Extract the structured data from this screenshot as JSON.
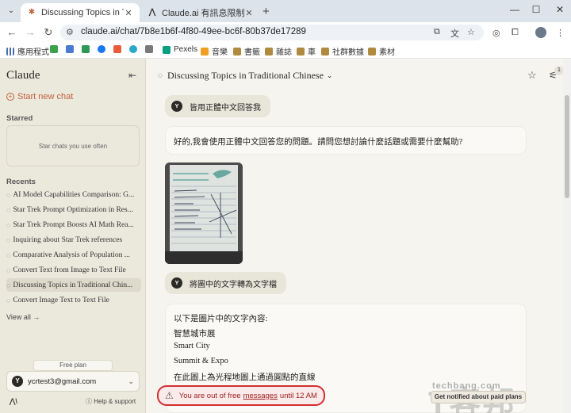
{
  "browser": {
    "tabs": [
      {
        "title": "Discussing Topics in Traditional",
        "active": true
      },
      {
        "title": "Claude.ai 有訊息限制嗎？| 人為",
        "active": false
      }
    ],
    "url": "claude.ai/chat/7b8e1b6f-4f80-49ee-bc6f-80b37de17289",
    "bookmarks": [
      "應用程式",
      "Pexels",
      "音樂",
      "書籤",
      "雜誌",
      "車",
      "社群數據",
      "素材"
    ]
  },
  "sidebar": {
    "logo": "Claude",
    "new_chat": "Start new chat",
    "starred_heading": "Starred",
    "starred_empty": "Star chats you use often",
    "recents_heading": "Recents",
    "recents": [
      "AI Model Capabilities Comparison: G...",
      "Star Trek Prompt Optimization in Res...",
      "Star Trek Prompt Boosts AI Math Rea...",
      "Inquiring about Star Trek references",
      "Comparative Analysis of Population ...",
      "Convert Text from Image to Text File",
      "Discussing Topics in Traditional Chin...",
      "Convert Image Text to Text File"
    ],
    "view_all": "View all →",
    "plan": "Free plan",
    "user_initial": "Y",
    "user_email": "ycrtest3@gmail.com",
    "help": "Help & support"
  },
  "chat": {
    "title": "Discussing Topics in Traditional Chinese",
    "badge_count": "1",
    "user_initial": "Y",
    "messages": {
      "user1": "皆用正體中文回答我",
      "ai1": "好的,我會使用正體中文回答您的問題。請問您想討論什麼話題或需要什麼幫助?",
      "user2": "將圖中的文字轉為文字檔",
      "ai2_lines": [
        "以下是圖片中的文字內容:",
        "智慧城市展",
        "Smart City",
        "Summit & Expo",
        "在此圖上為光程地圖上通過圓點的直線"
      ]
    },
    "limit": {
      "prefix": "You are out of free",
      "link": "messages",
      "suffix": "until 12 AM"
    },
    "notify_button": "Get notified about paid plans"
  },
  "watermark": {
    "main": "T客邦",
    "sub": "techbang.com"
  },
  "colors": {
    "accent": "#c15f3c",
    "warning_border": "#d32f2f"
  }
}
